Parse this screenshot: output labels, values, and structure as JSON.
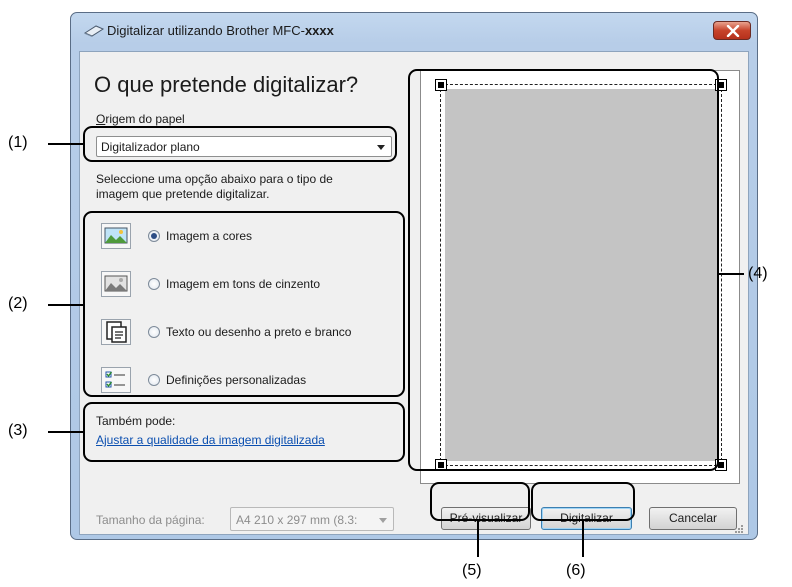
{
  "window": {
    "title_prefix": "Digitalizar utilizando Brother MFC-",
    "title_model": "xxxx"
  },
  "main": {
    "heading": "O que pretende digitalizar?",
    "paper_source_label": "Origem do papel",
    "paper_source_value": "Digitalizador plano",
    "instruction_line1": "Seleccione uma opção abaixo para o tipo de",
    "instruction_line2": "imagem que pretende digitalizar.",
    "options": [
      {
        "label": "Imagem a cores",
        "selected": true,
        "icon": "color-image-icon"
      },
      {
        "label": "Imagem em tons de cinzento",
        "selected": false,
        "icon": "grayscale-image-icon"
      },
      {
        "label": "Texto ou desenho a preto e branco",
        "selected": false,
        "icon": "text-document-icon"
      },
      {
        "label": "Definições personalizadas",
        "selected": false,
        "icon": "custom-settings-icon"
      }
    ],
    "also_label": "Também pode:",
    "quality_link": "Ajustar a qualidade da imagem digitalizada",
    "page_size_label": "Tamanho da página:",
    "page_size_value": "A4 210 x 297 mm (8.3:"
  },
  "buttons": {
    "preview": "Pré-visualizar",
    "scan": "Digitalizar",
    "cancel": "Cancelar"
  },
  "callouts": {
    "c1": "(1)",
    "c2": "(2)",
    "c3": "(3)",
    "c4": "(4)",
    "c5": "(5)",
    "c6": "(6)"
  },
  "colors": {
    "titlebar": "#b7cde8",
    "close_button": "#c7432a",
    "link": "#0b4fb0",
    "preview_area": "#c4c4c4",
    "radio_dot": "#2c4d85"
  }
}
